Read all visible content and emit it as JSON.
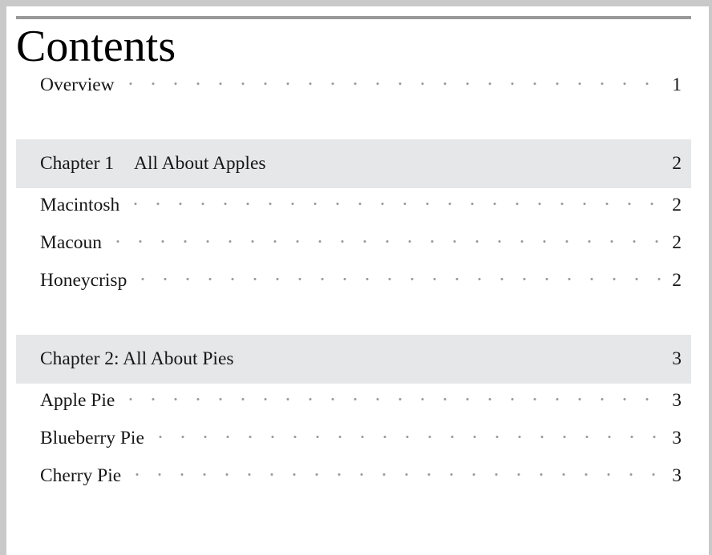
{
  "document": {
    "title": "Contents",
    "rule_color": "#999999",
    "page_background": "#ffffff",
    "frame_color": "#c9c9c9",
    "chapter_band_color": "#e6e7e9",
    "text_color": "#171717",
    "leader_dot_color": "#9a9aa0"
  },
  "toc": {
    "front_matter": [
      {
        "label": "Overview",
        "page": "1"
      }
    ],
    "sections": [
      {
        "chapter_number": "Chapter 1",
        "chapter_title": "All About Apples",
        "chapter_page": "2",
        "title_has_colon": false,
        "entries": [
          {
            "label": "Macintosh",
            "page": "2"
          },
          {
            "label": "Macoun",
            "page": "2"
          },
          {
            "label": "Honeycrisp",
            "page": "2"
          }
        ]
      },
      {
        "chapter_number": "Chapter 2: All About Pies",
        "chapter_title": "",
        "chapter_page": "3",
        "title_has_colon": true,
        "entries": [
          {
            "label": "Apple Pie",
            "page": "3"
          },
          {
            "label": "Blueberry Pie",
            "page": "3"
          },
          {
            "label": "Cherry Pie",
            "page": "3"
          }
        ]
      }
    ]
  }
}
